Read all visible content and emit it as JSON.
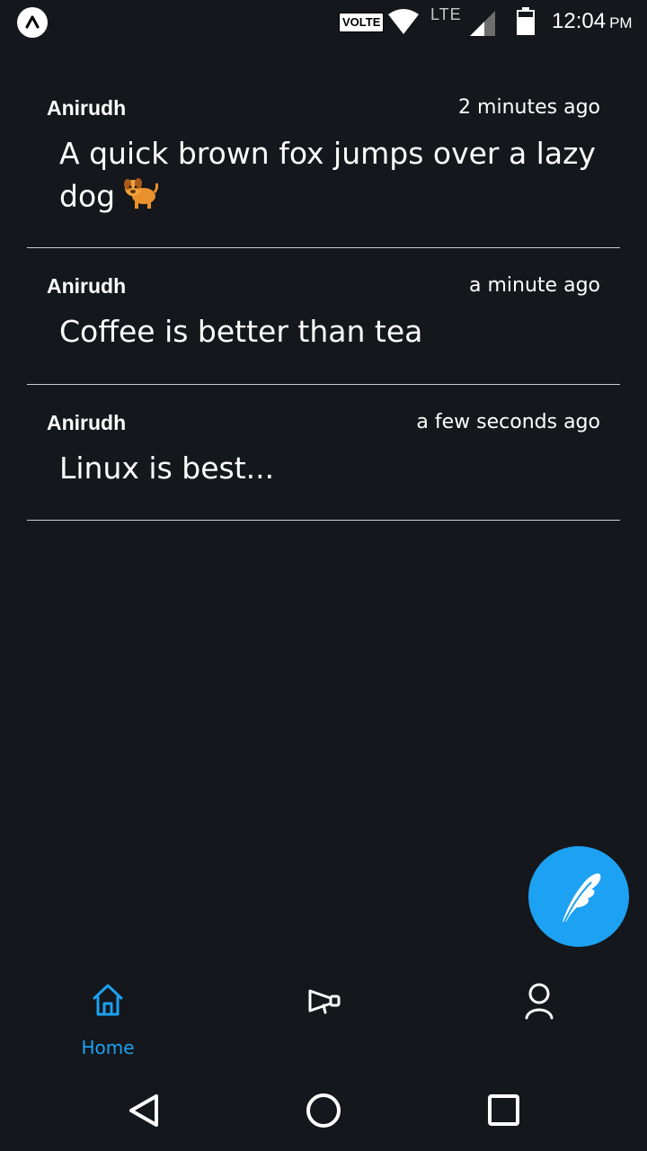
{
  "status_bar": {
    "volte": "VOLTE",
    "network": "LTE",
    "time": "12:04",
    "ampm": "PM",
    "icons": [
      "app-logo-icon",
      "wifi-icon",
      "signal-icon",
      "battery-icon"
    ]
  },
  "feed": {
    "posts": [
      {
        "author": "Anirudh",
        "time": "2 minutes ago",
        "text": "A quick brown fox jumps over a lazy dog",
        "emoji": "dog-icon"
      },
      {
        "author": "Anirudh",
        "time": "a minute ago",
        "text": "Coffee is better than tea"
      },
      {
        "author": "Anirudh",
        "time": "a few seconds ago",
        "text": "Linux is best..."
      }
    ]
  },
  "fab": {
    "icon": "feather-icon"
  },
  "bottom_nav": {
    "items": [
      {
        "label": "Home",
        "icon": "home-icon",
        "active": true
      },
      {
        "label": "",
        "icon": "megaphone-icon"
      },
      {
        "label": "",
        "icon": "user-icon"
      }
    ]
  },
  "colors": {
    "background": "#14171b",
    "accent": "#1da1f2",
    "divider": "#d0d0d0",
    "text": "#ffffff"
  }
}
